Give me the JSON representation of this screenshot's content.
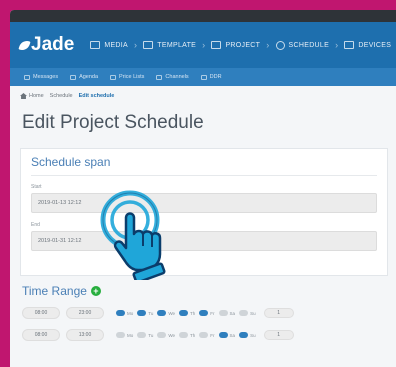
{
  "app": {
    "logo_text": "Jade"
  },
  "navbar": {
    "items": [
      {
        "label": "MEDIA",
        "icon": "media-icon"
      },
      {
        "label": "TEMPLATE",
        "icon": "template-icon"
      },
      {
        "label": "PROJECT",
        "icon": "project-icon"
      },
      {
        "label": "SCHEDULE",
        "icon": "clock-icon"
      },
      {
        "label": "DEVICES",
        "icon": "monitor-icon"
      }
    ]
  },
  "subnav": {
    "items": [
      {
        "label": "Messages",
        "icon": "message-icon"
      },
      {
        "label": "Agenda",
        "icon": "calendar-icon"
      },
      {
        "label": "Price Lists",
        "icon": "list-icon"
      },
      {
        "label": "Channels",
        "icon": "channels-icon"
      },
      {
        "label": "DDR",
        "icon": "ddr-icon"
      }
    ]
  },
  "breadcrumb": {
    "home": "Home",
    "section": "Schedule",
    "current": "Edit schedule"
  },
  "page": {
    "title": "Edit Project Schedule"
  },
  "schedule_span": {
    "title": "Schedule span",
    "start_label": "Start",
    "start_value": "2019-01-13 12:12",
    "end_label": "End",
    "end_value": "2019-01-31 12:12"
  },
  "time_range": {
    "title": "Time Range",
    "rows": [
      {
        "from": "08:00",
        "to": "23:00",
        "days": [
          {
            "label": "Mo",
            "on": true
          },
          {
            "label": "Tu",
            "on": true
          },
          {
            "label": "We",
            "on": true
          },
          {
            "label": "Th",
            "on": true
          },
          {
            "label": "Fr",
            "on": true
          },
          {
            "label": "Sa",
            "on": false
          },
          {
            "label": "Su",
            "on": false
          }
        ],
        "count": "1"
      },
      {
        "from": "08:00",
        "to": "13:00",
        "days": [
          {
            "label": "Mo",
            "on": false
          },
          {
            "label": "Tu",
            "on": false
          },
          {
            "label": "We",
            "on": false
          },
          {
            "label": "Th",
            "on": false
          },
          {
            "label": "Fr",
            "on": false
          },
          {
            "label": "Sa",
            "on": true
          },
          {
            "label": "Su",
            "on": true
          }
        ],
        "count": "1"
      }
    ]
  },
  "colors": {
    "background": "#c0166f",
    "navbar": "#1e6fae",
    "subnav": "#2f7fbe",
    "accent": "#27ae3e",
    "hand": "#1fa6d9"
  }
}
